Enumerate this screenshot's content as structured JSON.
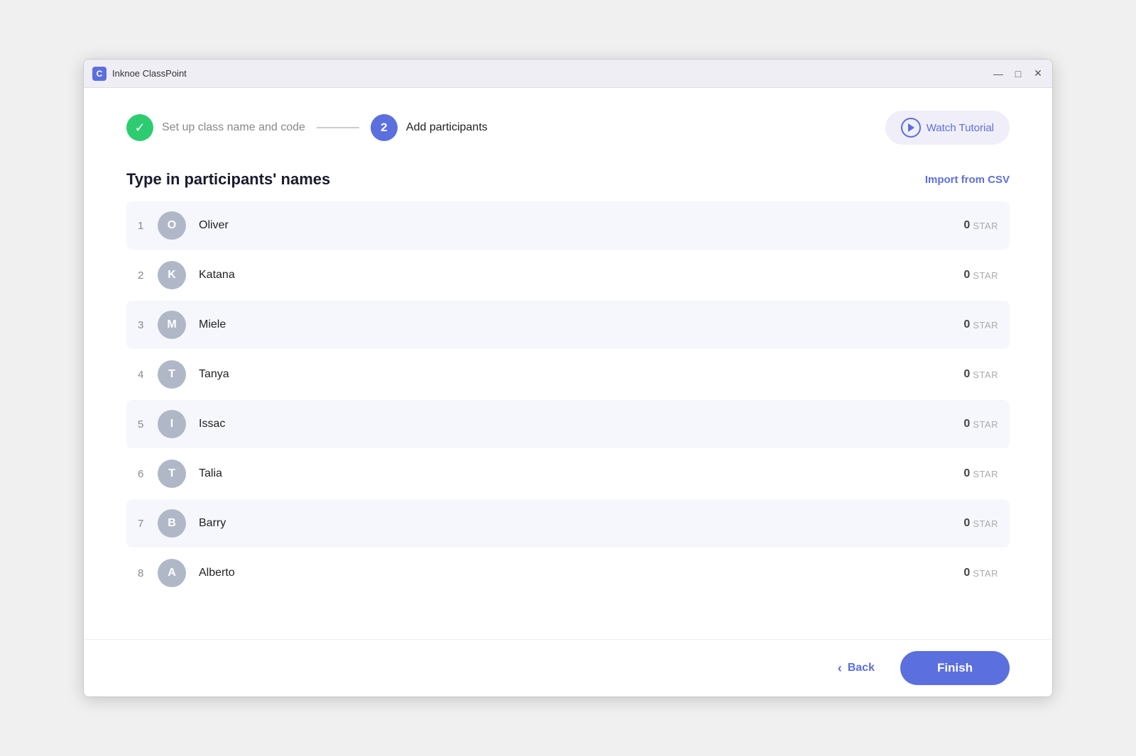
{
  "titlebar": {
    "icon_label": "C",
    "title": "Inknoe ClassPoint",
    "minimize_label": "—",
    "maximize_label": "□",
    "close_label": "✕"
  },
  "steps": {
    "step1": {
      "label": "Set up class name and code",
      "completed": true
    },
    "step2": {
      "number": "2",
      "label": "Add participants",
      "active": true
    }
  },
  "watch_tutorial": {
    "label": "Watch Tutorial"
  },
  "section": {
    "title": "Type in participants' names",
    "import_csv_label": "Import from CSV"
  },
  "participants": [
    {
      "number": "1",
      "initial": "O",
      "name": "Oliver",
      "stars": "0",
      "star_label": "STAR"
    },
    {
      "number": "2",
      "initial": "K",
      "name": "Katana",
      "stars": "0",
      "star_label": "STAR"
    },
    {
      "number": "3",
      "initial": "M",
      "name": "Miele",
      "stars": "0",
      "star_label": "STAR"
    },
    {
      "number": "4",
      "initial": "T",
      "name": "Tanya",
      "stars": "0",
      "star_label": "STAR"
    },
    {
      "number": "5",
      "initial": "I",
      "name": "Issac",
      "stars": "0",
      "star_label": "STAR"
    },
    {
      "number": "6",
      "initial": "T",
      "name": "Talia",
      "stars": "0",
      "star_label": "STAR"
    },
    {
      "number": "7",
      "initial": "B",
      "name": "Barry",
      "stars": "0",
      "star_label": "STAR"
    },
    {
      "number": "8",
      "initial": "A",
      "name": "Alberto",
      "stars": "0",
      "star_label": "STAR"
    }
  ],
  "bottom": {
    "back_label": "Back",
    "finish_label": "Finish"
  }
}
